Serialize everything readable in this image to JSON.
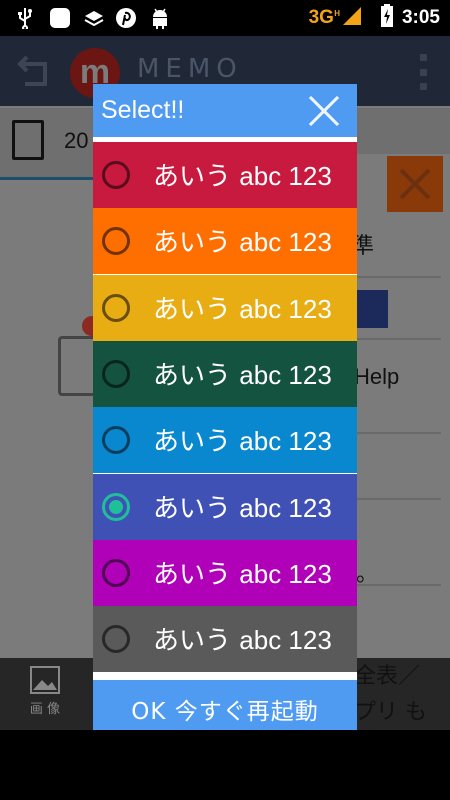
{
  "status_bar": {
    "network": "3G",
    "network_sup": "H",
    "time": "3:05",
    "icons": [
      "usb-icon",
      "app-square-icon",
      "stack-icon",
      "pinterest-icon",
      "android-icon",
      "signal-icon",
      "battery-charging-icon"
    ]
  },
  "app": {
    "title": "MEMO",
    "logo_letter": "m",
    "row_text": "20",
    "bg_texts": [
      "準",
      "Help",
      "。",
      "全表／",
      "プリ も"
    ],
    "bottom_tab_label": "画 像"
  },
  "dialog": {
    "title": "Select!!",
    "ok_label": "OK 今すぐ再起動",
    "options": [
      {
        "label_jp": "あいう",
        "label_en": "abc 123",
        "color": "#c8193f",
        "checked": false
      },
      {
        "label_jp": "あいう",
        "label_en": "abc 123",
        "color": "#ff6f00",
        "checked": false
      },
      {
        "label_jp": "あいう",
        "label_en": "abc 123",
        "color": "#e7ad13",
        "checked": false
      },
      {
        "label_jp": "あいう",
        "label_en": "abc 123",
        "color": "#135340",
        "checked": false
      },
      {
        "label_jp": "あいう",
        "label_en": "abc 123",
        "color": "#0a88cf",
        "checked": false
      },
      {
        "label_jp": "あいう",
        "label_en": "abc 123",
        "color": "#3f51b5",
        "checked": true
      },
      {
        "label_jp": "あいう",
        "label_en": "abc 123",
        "color": "#b000b8",
        "checked": false
      },
      {
        "label_jp": "あいう",
        "label_en": "abc 123",
        "color": "#5a5a5a",
        "checked": false
      }
    ]
  },
  "colors": {
    "accent": "#4f9bf2",
    "radio_checked": "#1fbf9a"
  }
}
